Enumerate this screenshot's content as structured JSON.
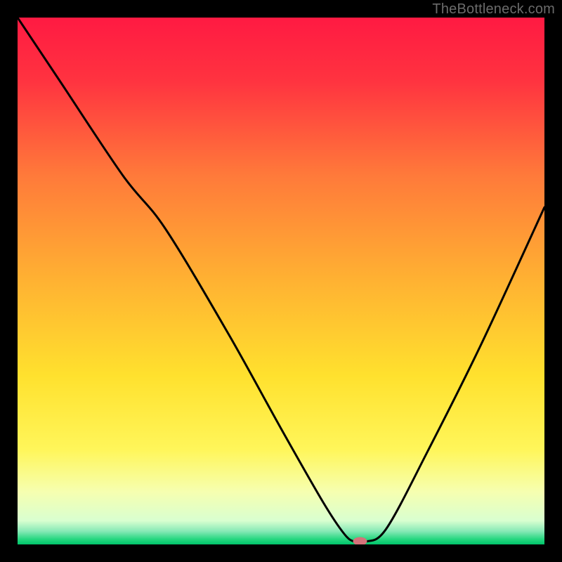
{
  "watermark": "TheBottleneck.com",
  "chart_data": {
    "type": "line",
    "title": "",
    "xlabel": "",
    "ylabel": "",
    "xlim": [
      0,
      100
    ],
    "ylim": [
      0,
      100
    ],
    "background_gradient": {
      "stops": [
        {
          "offset": 0.0,
          "color": "#ff1a42"
        },
        {
          "offset": 0.12,
          "color": "#ff3340"
        },
        {
          "offset": 0.3,
          "color": "#ff7a3a"
        },
        {
          "offset": 0.5,
          "color": "#ffb232"
        },
        {
          "offset": 0.68,
          "color": "#ffe12e"
        },
        {
          "offset": 0.82,
          "color": "#fff65a"
        },
        {
          "offset": 0.9,
          "color": "#f6ffb0"
        },
        {
          "offset": 0.955,
          "color": "#d9ffd0"
        },
        {
          "offset": 0.975,
          "color": "#86e9b6"
        },
        {
          "offset": 0.99,
          "color": "#26d780"
        },
        {
          "offset": 1.0,
          "color": "#00c46a"
        }
      ]
    },
    "series": [
      {
        "name": "bottleneck-curve",
        "x": [
          0,
          8,
          20,
          28,
          40,
          50,
          58,
          62,
          64,
          66,
          70,
          78,
          88,
          100
        ],
        "y": [
          100,
          88,
          70,
          60,
          40,
          22,
          8,
          2,
          0.5,
          0.5,
          3,
          18,
          38,
          64
        ]
      }
    ],
    "marker": {
      "x": 65,
      "y": 0.6,
      "color": "#d4727a",
      "rx": 10,
      "ry": 6
    }
  }
}
